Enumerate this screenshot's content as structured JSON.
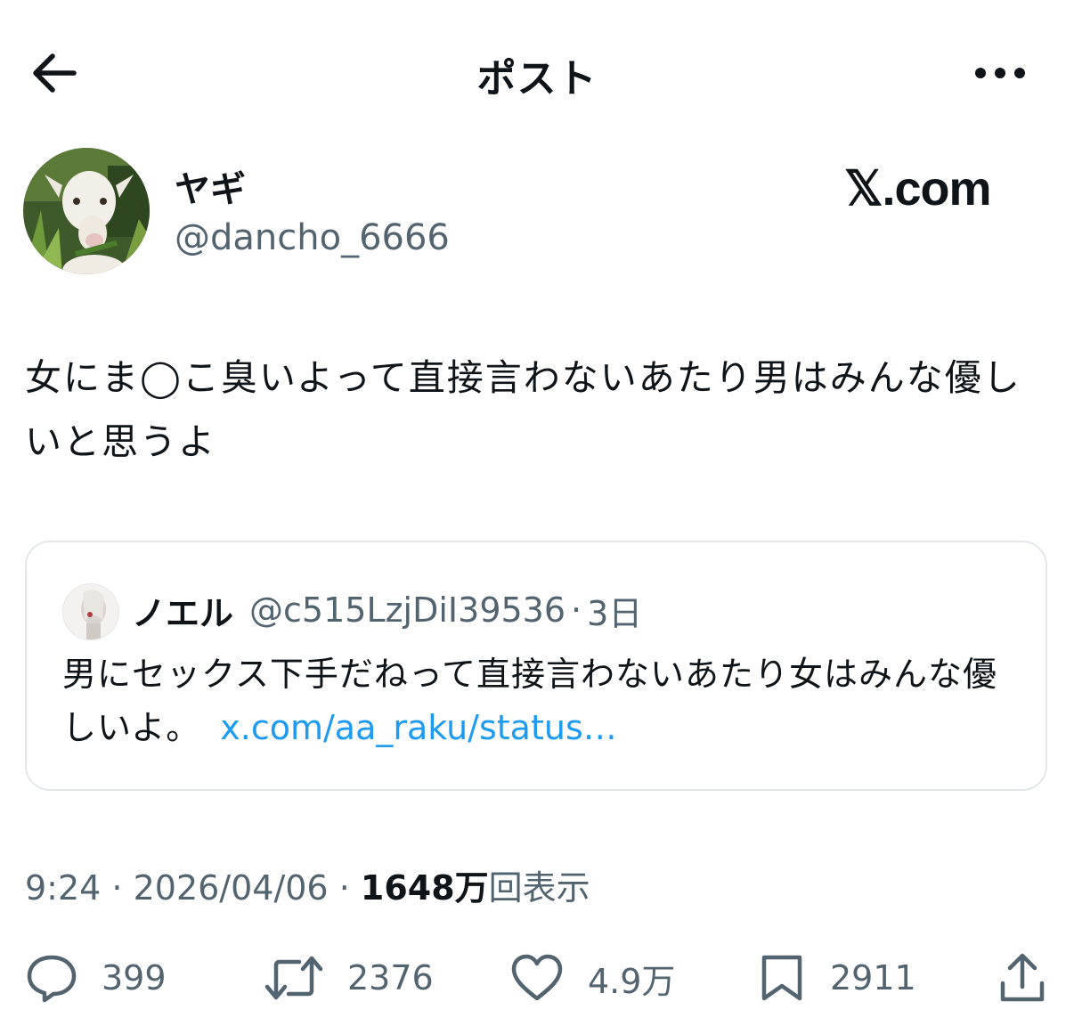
{
  "header": {
    "title": "ポスト",
    "back_icon": "arrow-left-icon",
    "more_icon": "more-horizontal-icon"
  },
  "author": {
    "display_name": "ヤギ",
    "handle": "@dancho_6666",
    "avatar_icon": "goat-avatar"
  },
  "brand": {
    "logo_text": "𝕏.com"
  },
  "post": {
    "text": "女にま◯こ臭いよって直接言わないあたり男はみんな優しいと思うよ"
  },
  "quote": {
    "display_name": "ノエル",
    "handle": "@c515LzjDiI39536",
    "separator": "·",
    "time": "3日",
    "text": "男にセックス下手だねって直接言わないあたり女はみんな優しいよ。",
    "link_text": "x.com/aa_raku/status…"
  },
  "meta": {
    "time": "9:24",
    "sep1": " · ",
    "date": "2026/04/06",
    "sep2": " · ",
    "views_count": "1648万",
    "views_label": "回表示"
  },
  "actions": {
    "reply": {
      "icon": "reply-icon",
      "count": "399"
    },
    "repost": {
      "icon": "repost-icon",
      "count": "2376"
    },
    "like": {
      "icon": "heart-icon",
      "count": "4.9万"
    },
    "bookmark": {
      "icon": "bookmark-icon",
      "count": "2911"
    },
    "share": {
      "icon": "share-icon"
    }
  },
  "colors": {
    "text": "#0f1419",
    "secondary": "#536471",
    "link": "#1d9bf0",
    "border": "#e3e7ea"
  }
}
